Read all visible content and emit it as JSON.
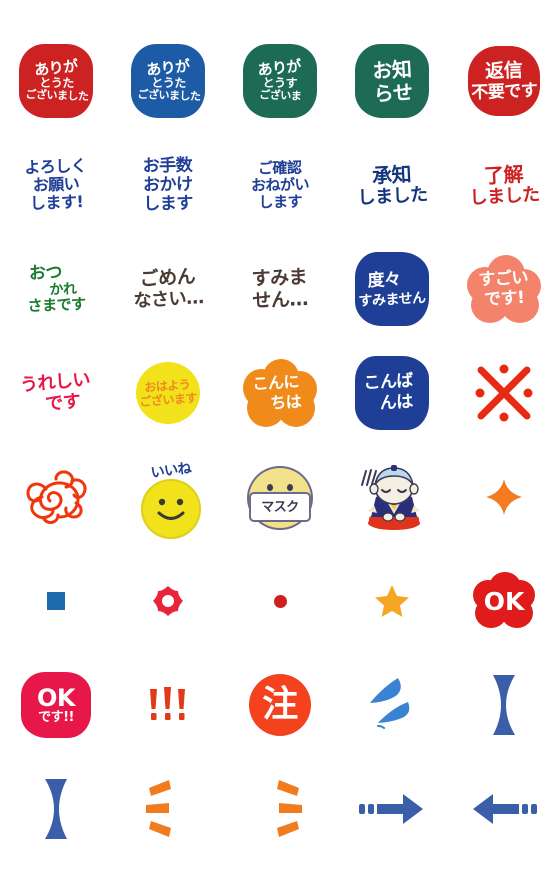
{
  "page": {
    "title": "Japanese Message Emoji Sticker Set",
    "background_color": "#ffffff",
    "grid": {
      "columns": 5,
      "rows": 8,
      "total_items": 40
    }
  },
  "palette": {
    "red": "#cc2222",
    "crimson": "#e8174a",
    "orange_red": "#f4421e",
    "orange": "#ef8a1b",
    "orange_light": "#f08a2a",
    "blue": "#1d5ba6",
    "navy": "#1f3f96",
    "navy_dark": "#16357f",
    "teal_green": "#1d6b55",
    "green": "#1a7a2e",
    "dark_green": "#156b4a",
    "salmon": "#f4836c",
    "yellow": "#f2e21c",
    "gold": "#f5a623",
    "steel_blue": "#3a5fa8",
    "sky_blue": "#3a82d2",
    "brown": "#4a3a33",
    "white": "#ffffff"
  },
  "stickers": [
    {
      "id": 1,
      "row": 1,
      "col": 1,
      "name": "arigatou-gozaimashita-red",
      "text": "ありがとうございました",
      "lines": [
        "ありが",
        "とうた",
        "ございました"
      ],
      "style": "filled-blob",
      "bg": "#cc2222",
      "fg": "#ffffff"
    },
    {
      "id": 2,
      "row": 1,
      "col": 2,
      "name": "arigatou-gozaimashita-blue",
      "text": "ありがとうございました",
      "lines": [
        "ありが",
        "とうた",
        "ございました"
      ],
      "style": "filled-blob",
      "bg": "#1d5ba6",
      "fg": "#ffffff"
    },
    {
      "id": 3,
      "row": 1,
      "col": 3,
      "name": "arigatou-gozaimasu-green",
      "text": "ありがとうございます",
      "lines": [
        "ありが",
        "とうす",
        "ございま"
      ],
      "style": "filled-blob",
      "bg": "#1d6b55",
      "fg": "#ffffff"
    },
    {
      "id": 4,
      "row": 1,
      "col": 4,
      "name": "oshirase-green",
      "text": "お知らせ",
      "lines": [
        "お知",
        "らせ"
      ],
      "style": "filled-blob",
      "bg": "#1d6b55",
      "fg": "#ffffff"
    },
    {
      "id": 5,
      "row": 1,
      "col": 5,
      "name": "henshin-fuyou-desu-red",
      "text": "返信不要です",
      "lines": [
        "返信",
        "不要です"
      ],
      "style": "filled-blob",
      "bg": "#cc2222",
      "fg": "#ffffff"
    },
    {
      "id": 6,
      "row": 2,
      "col": 1,
      "name": "yoroshiku-onegai-shimasu",
      "text": "よろしくお願いします!",
      "lines": [
        "よろしく",
        "お願い",
        "します!"
      ],
      "style": "outlined-text",
      "fg": "#1f3f96",
      "outline": "#ffffff"
    },
    {
      "id": 7,
      "row": 2,
      "col": 2,
      "name": "otesuu-okake-shimasu",
      "text": "お手数おかけします",
      "lines": [
        "お手数",
        "おかけ",
        "します"
      ],
      "style": "outlined-text",
      "fg": "#1f3f96",
      "outline": "#ffffff"
    },
    {
      "id": 8,
      "row": 2,
      "col": 3,
      "name": "gokakunin-onegaishimasu",
      "text": "ご確認おねがいします",
      "lines": [
        "ご確認",
        "おねがい",
        "します"
      ],
      "style": "outlined-text",
      "fg": "#1f3f96",
      "outline": "#ffffff"
    },
    {
      "id": 9,
      "row": 2,
      "col": 4,
      "name": "shouchi-shimashita",
      "text": "承知しました",
      "lines": [
        "承知",
        "しました"
      ],
      "style": "outlined-text",
      "fg": "#16357f",
      "outline": "#ffffff"
    },
    {
      "id": 10,
      "row": 2,
      "col": 5,
      "name": "ryoukai-shimashita",
      "text": "了解しました",
      "lines": [
        "了解",
        "しました"
      ],
      "style": "outlined-text",
      "fg": "#cc2222",
      "outline": "#ffffff"
    },
    {
      "id": 11,
      "row": 3,
      "col": 1,
      "name": "otsukaresama-desu",
      "text": "おつかれさまです",
      "lines": [
        "おつ",
        "かれ",
        "さまです"
      ],
      "style": "outlined-text",
      "fg": "#1a7a2e",
      "outline": "#ffffff"
    },
    {
      "id": 12,
      "row": 3,
      "col": 2,
      "name": "gomennasai",
      "text": "ごめんなさい…",
      "lines": [
        "ごめん",
        "なさい…"
      ],
      "style": "outlined-text",
      "fg": "#4a3a33",
      "outline": "#ffffff"
    },
    {
      "id": 13,
      "row": 3,
      "col": 3,
      "name": "sumimasen",
      "text": "すみません…",
      "lines": [
        "すみま",
        "せん…"
      ],
      "style": "outlined-text",
      "fg": "#4a3a33",
      "outline": "#ffffff"
    },
    {
      "id": 14,
      "row": 3,
      "col": 4,
      "name": "tabitabi-sumimasen",
      "text": "度々すみません",
      "lines": [
        "度々",
        "すみません"
      ],
      "style": "filled-blob",
      "bg": "#1f3f96",
      "fg": "#ffffff"
    },
    {
      "id": 15,
      "row": 3,
      "col": 5,
      "name": "sugoi-desu",
      "text": "すごいです!",
      "lines": [
        "すごい",
        "です!"
      ],
      "style": "filled-cloud",
      "bg": "#f4836c",
      "fg": "#ffffff"
    },
    {
      "id": 16,
      "row": 4,
      "col": 1,
      "name": "ureshii-desu",
      "text": "うれしいです",
      "lines": [
        "うれしい",
        "です"
      ],
      "style": "outlined-text",
      "fg": "#e8174a",
      "outline": "#ffffff"
    },
    {
      "id": 17,
      "row": 4,
      "col": 2,
      "name": "ohayou-gozaimasu-sun",
      "text": "おはようございます",
      "lines": [
        "おはよう",
        "ございます"
      ],
      "style": "sun",
      "bg": "#f2e21c",
      "fg": "#ef8a1b"
    },
    {
      "id": 18,
      "row": 4,
      "col": 3,
      "name": "konnichiwa",
      "text": "こんにちは",
      "lines": [
        "こんに",
        "ちは"
      ],
      "style": "filled-cloud",
      "bg": "#ef8a1b",
      "fg": "#ffffff"
    },
    {
      "id": 19,
      "row": 4,
      "col": 4,
      "name": "konbanwa",
      "text": "こんばんは",
      "lines": [
        "こんば",
        "んは"
      ],
      "style": "filled-blob",
      "bg": "#1f3f96",
      "fg": "#ffffff"
    },
    {
      "id": 20,
      "row": 4,
      "col": 5,
      "name": "red-x-mark",
      "text": "",
      "style": "icon-x-mark",
      "fg": "#e82a12"
    },
    {
      "id": 21,
      "row": 5,
      "col": 1,
      "name": "red-scribble-spiral",
      "text": "",
      "style": "icon-scribble",
      "fg": "#f0360c"
    },
    {
      "id": 22,
      "row": 5,
      "col": 2,
      "name": "iine-smiley",
      "text": "いいね",
      "style": "smiley",
      "bg": "#f2e21c",
      "fg": "#1f3f96"
    },
    {
      "id": 23,
      "row": 5,
      "col": 3,
      "name": "masuku-face-mask",
      "text": "マスク",
      "style": "mask-face",
      "bg": "#f2e08a",
      "fg": "#3a3a55"
    },
    {
      "id": 24,
      "row": 5,
      "col": 4,
      "name": "bowing-person",
      "text": "",
      "style": "bowing-person",
      "fg": "#2a2f7a"
    },
    {
      "id": 25,
      "row": 5,
      "col": 5,
      "name": "orange-diamond-sparkle",
      "text": "",
      "style": "icon-diamond",
      "fg": "#f47b20"
    },
    {
      "id": 26,
      "row": 6,
      "col": 1,
      "name": "blue-square",
      "text": "",
      "style": "icon-square",
      "fg": "#1d6aad"
    },
    {
      "id": 27,
      "row": 6,
      "col": 2,
      "name": "red-flower-ring",
      "text": "",
      "style": "icon-flower-ring",
      "fg": "#e8243a"
    },
    {
      "id": 28,
      "row": 6,
      "col": 3,
      "name": "red-dot",
      "text": "",
      "style": "icon-dot",
      "fg": "#cc1f1f"
    },
    {
      "id": 29,
      "row": 6,
      "col": 4,
      "name": "orange-star",
      "text": "",
      "style": "icon-star",
      "fg": "#f5a623"
    },
    {
      "id": 30,
      "row": 6,
      "col": 5,
      "name": "ok-stamp-red",
      "text": "OK",
      "style": "ok-blob",
      "bg": "#e01b1b",
      "fg": "#ffffff"
    },
    {
      "id": 31,
      "row": 7,
      "col": 1,
      "name": "ok-desu-stamp",
      "text": "OKです!!",
      "lines": [
        "OK",
        "です!!"
      ],
      "style": "filled-blob",
      "bg": "#e8174a",
      "fg": "#ffffff"
    },
    {
      "id": 32,
      "row": 7,
      "col": 2,
      "name": "triple-exclamation",
      "text": "!!!",
      "style": "excl-burst",
      "bg": "#ffffff",
      "fg": "#e03a1a"
    },
    {
      "id": 33,
      "row": 7,
      "col": 3,
      "name": "chuu-caution-stamp",
      "text": "注",
      "style": "filled-circle",
      "bg": "#f4421e",
      "fg": "#ffffff"
    },
    {
      "id": 34,
      "row": 7,
      "col": 4,
      "name": "blue-sweat-drops",
      "text": "",
      "style": "icon-sweat",
      "fg": "#3a82d2"
    },
    {
      "id": 35,
      "row": 7,
      "col": 5,
      "name": "bracket-open",
      "text": "(",
      "style": "icon-bracket-left",
      "fg": "#3a5fa8"
    },
    {
      "id": 36,
      "row": 8,
      "col": 1,
      "name": "bracket-close",
      "text": ")",
      "style": "icon-bracket-right",
      "fg": "#3a5fa8"
    },
    {
      "id": 37,
      "row": 8,
      "col": 2,
      "name": "speed-lines-right",
      "text": "",
      "style": "icon-speedlines-right",
      "fg": "#f07c1e"
    },
    {
      "id": 38,
      "row": 8,
      "col": 3,
      "name": "speed-lines-left",
      "text": "",
      "style": "icon-speedlines-left",
      "fg": "#f07c1e"
    },
    {
      "id": 39,
      "row": 8,
      "col": 4,
      "name": "arrow-right",
      "text": "",
      "style": "icon-arrow-right",
      "fg": "#3a5fa8"
    },
    {
      "id": 40,
      "row": 8,
      "col": 5,
      "name": "arrow-left",
      "text": "",
      "style": "icon-arrow-left",
      "fg": "#3a5fa8"
    }
  ]
}
